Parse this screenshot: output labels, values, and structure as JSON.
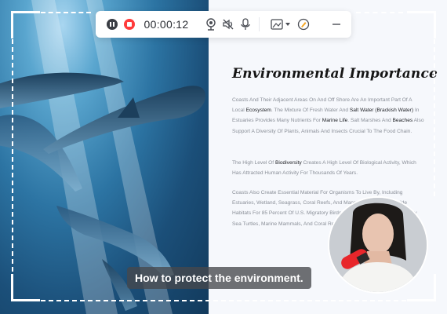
{
  "toolbar": {
    "timer": "00:00:12",
    "icons": [
      "pause-icon",
      "stop-record-icon",
      "webcam-icon",
      "speaker-mute-icon",
      "microphone-icon",
      "screenshot-icon",
      "dropdown-chevron-icon",
      "annotate-pen-icon",
      "minimize-icon"
    ],
    "colors": {
      "stop": "#ff3b3b",
      "pause": "#3a3d44"
    }
  },
  "document": {
    "title": "Environmental Importance",
    "p1": {
      "t1": "Coasts And Their Adjacent Areas On And Off Shore Are An Important Part Of A Local ",
      "h1": "Ecosystem",
      "t2": ". The Mixture Of Fresh Water And ",
      "h2": "Salt Water (Brackish Water)",
      "t3": " In Estuaries Provides Many Nutrients For ",
      "h3": "Marine Life",
      "t4": ". Salt Marshes And ",
      "h4": "Beaches",
      "t5": " Also Support A Diversity Of Plants, Animals And Insects Crucial To The Food Chain."
    },
    "p2": {
      "t1": "The High Level Of ",
      "h1": "Biodiversity",
      "t2": " Creates A High Level Of Biological Activity, Which Has Attracted Human Activity For Thousands Of Years."
    },
    "p3": "Coasts Also Create Essential Material For Organisms To Live By, Including Estuaries, Wetland, Seagrass, Coral Reefs, And Mangroves. Coasts Provide Habitats For 85 Percent Of U.S. Migratory Birds. Coasts Are Also Home To Many Sea Turtles, Marine Mammals, And Coral Reefs."
  },
  "caption": "How to protect the environment.",
  "colors": {
    "frame": "#ffffff",
    "caption_bg": "#46484c"
  }
}
